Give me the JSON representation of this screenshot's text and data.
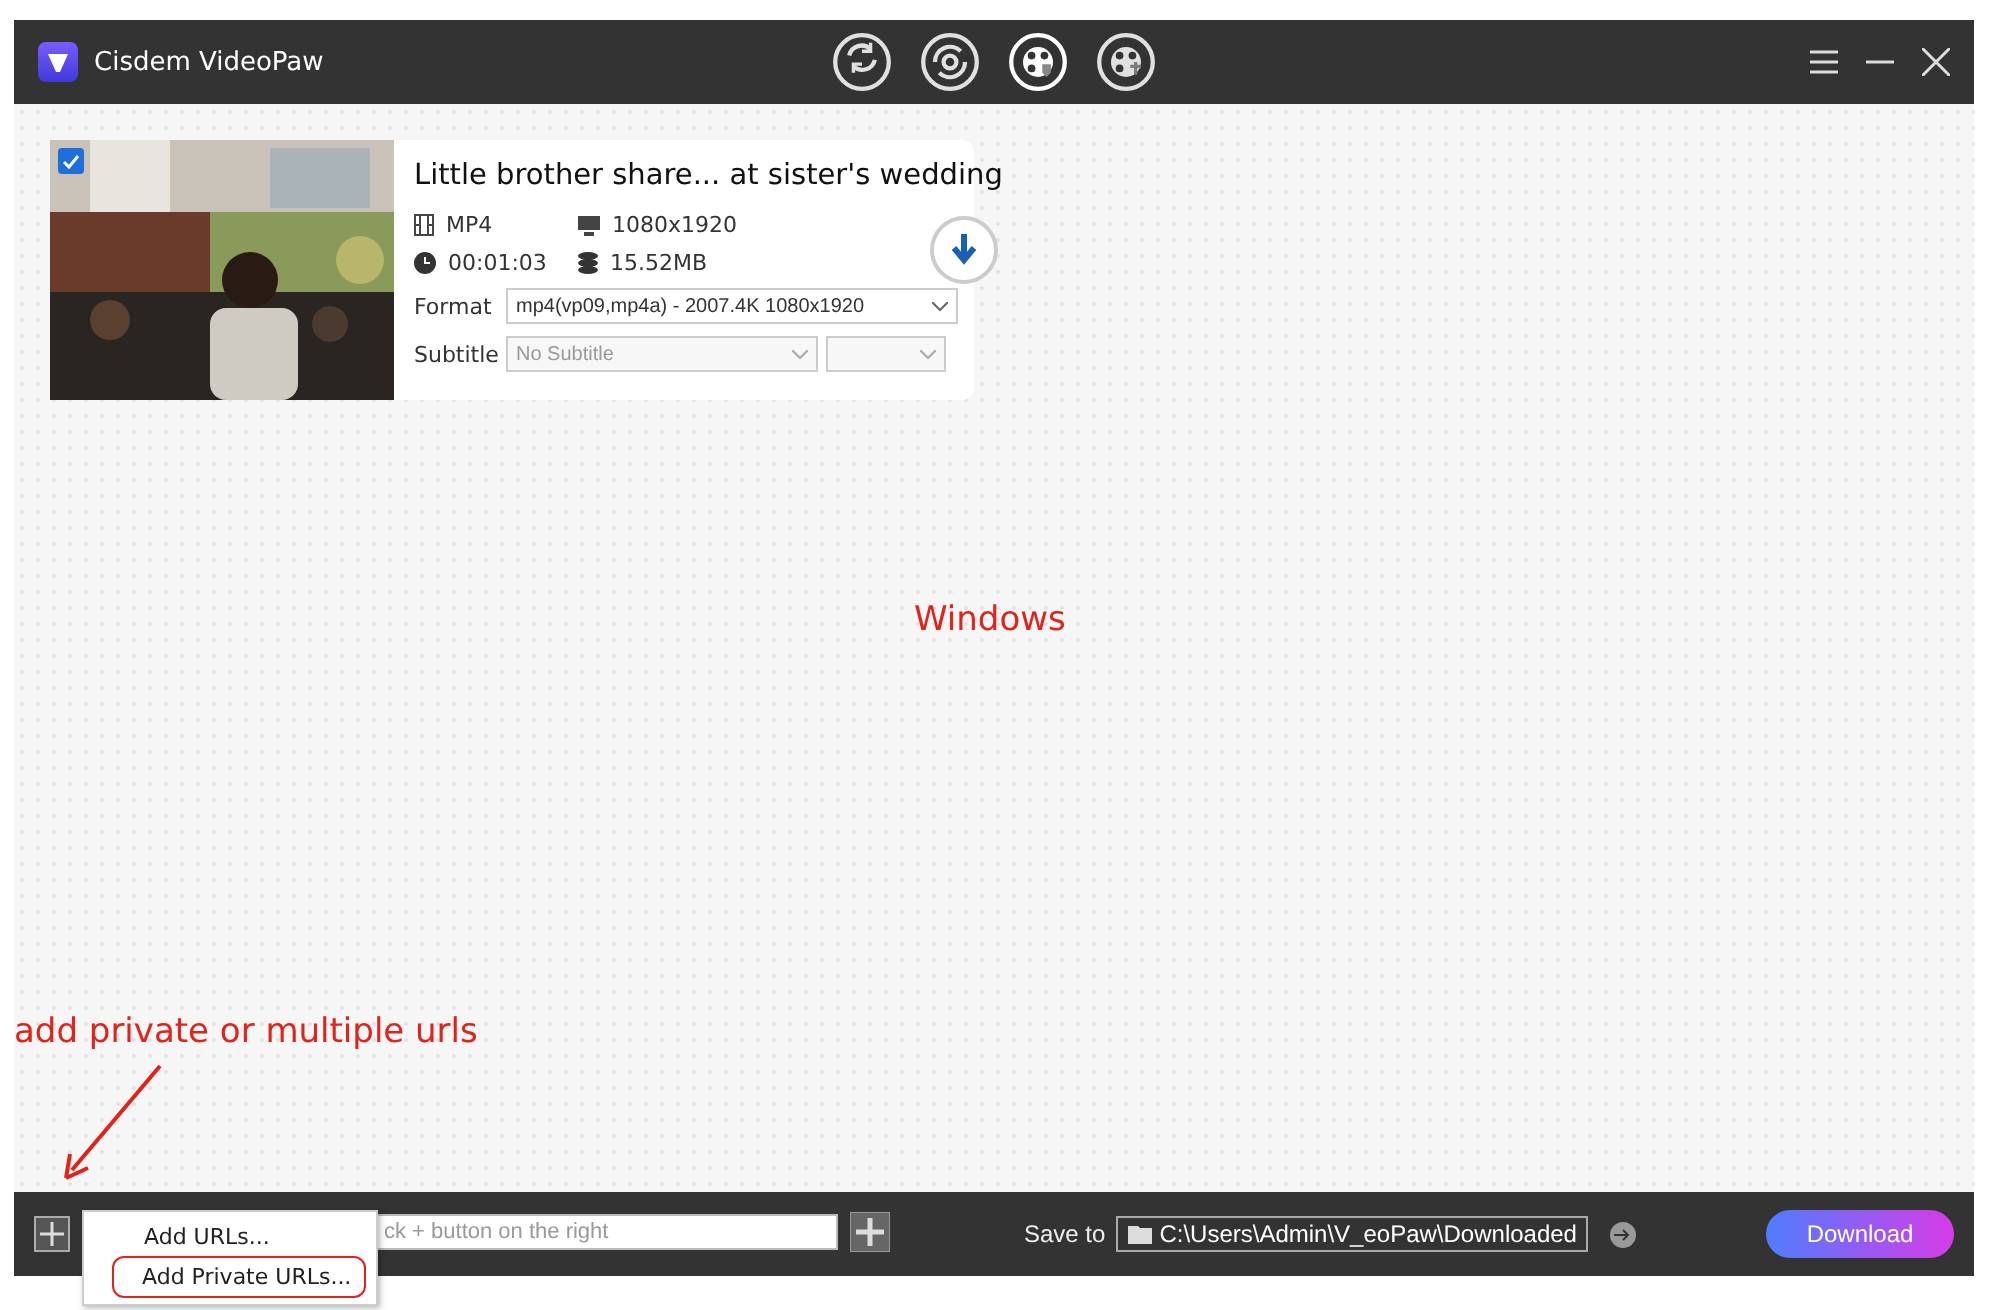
{
  "window": {
    "title": "Cisdem VideoPaw"
  },
  "tabs": [
    {
      "selected": false
    },
    {
      "selected": false
    },
    {
      "selected": true
    },
    {
      "selected": false
    }
  ],
  "video": {
    "checked": true,
    "title": "Little brother share... at sister's wedding",
    "container": "MP4",
    "resolution": "1080x1920",
    "duration": "00:01:03",
    "size": "15.52MB",
    "format_label": "Format",
    "format_value": "mp4(vp09,mp4a) - 2007.4K 1080x1920",
    "subtitle_label": "Subtitle",
    "subtitle_value": "No Subtitle"
  },
  "bottom_bar": {
    "url_placeholder": "ck + button on the right",
    "save_label": "Save to",
    "save_path": "C:\\Users\\Admin\\V_eoPaw\\Downloaded",
    "download": "Download"
  },
  "add_menu": {
    "items": [
      {
        "label": "Add URLs...",
        "highlighted": false
      },
      {
        "label": "Add Private URLs...",
        "highlighted": true
      }
    ]
  },
  "annotations": {
    "center_note": "Windows",
    "bottom_note": "add private or multiple urls"
  }
}
